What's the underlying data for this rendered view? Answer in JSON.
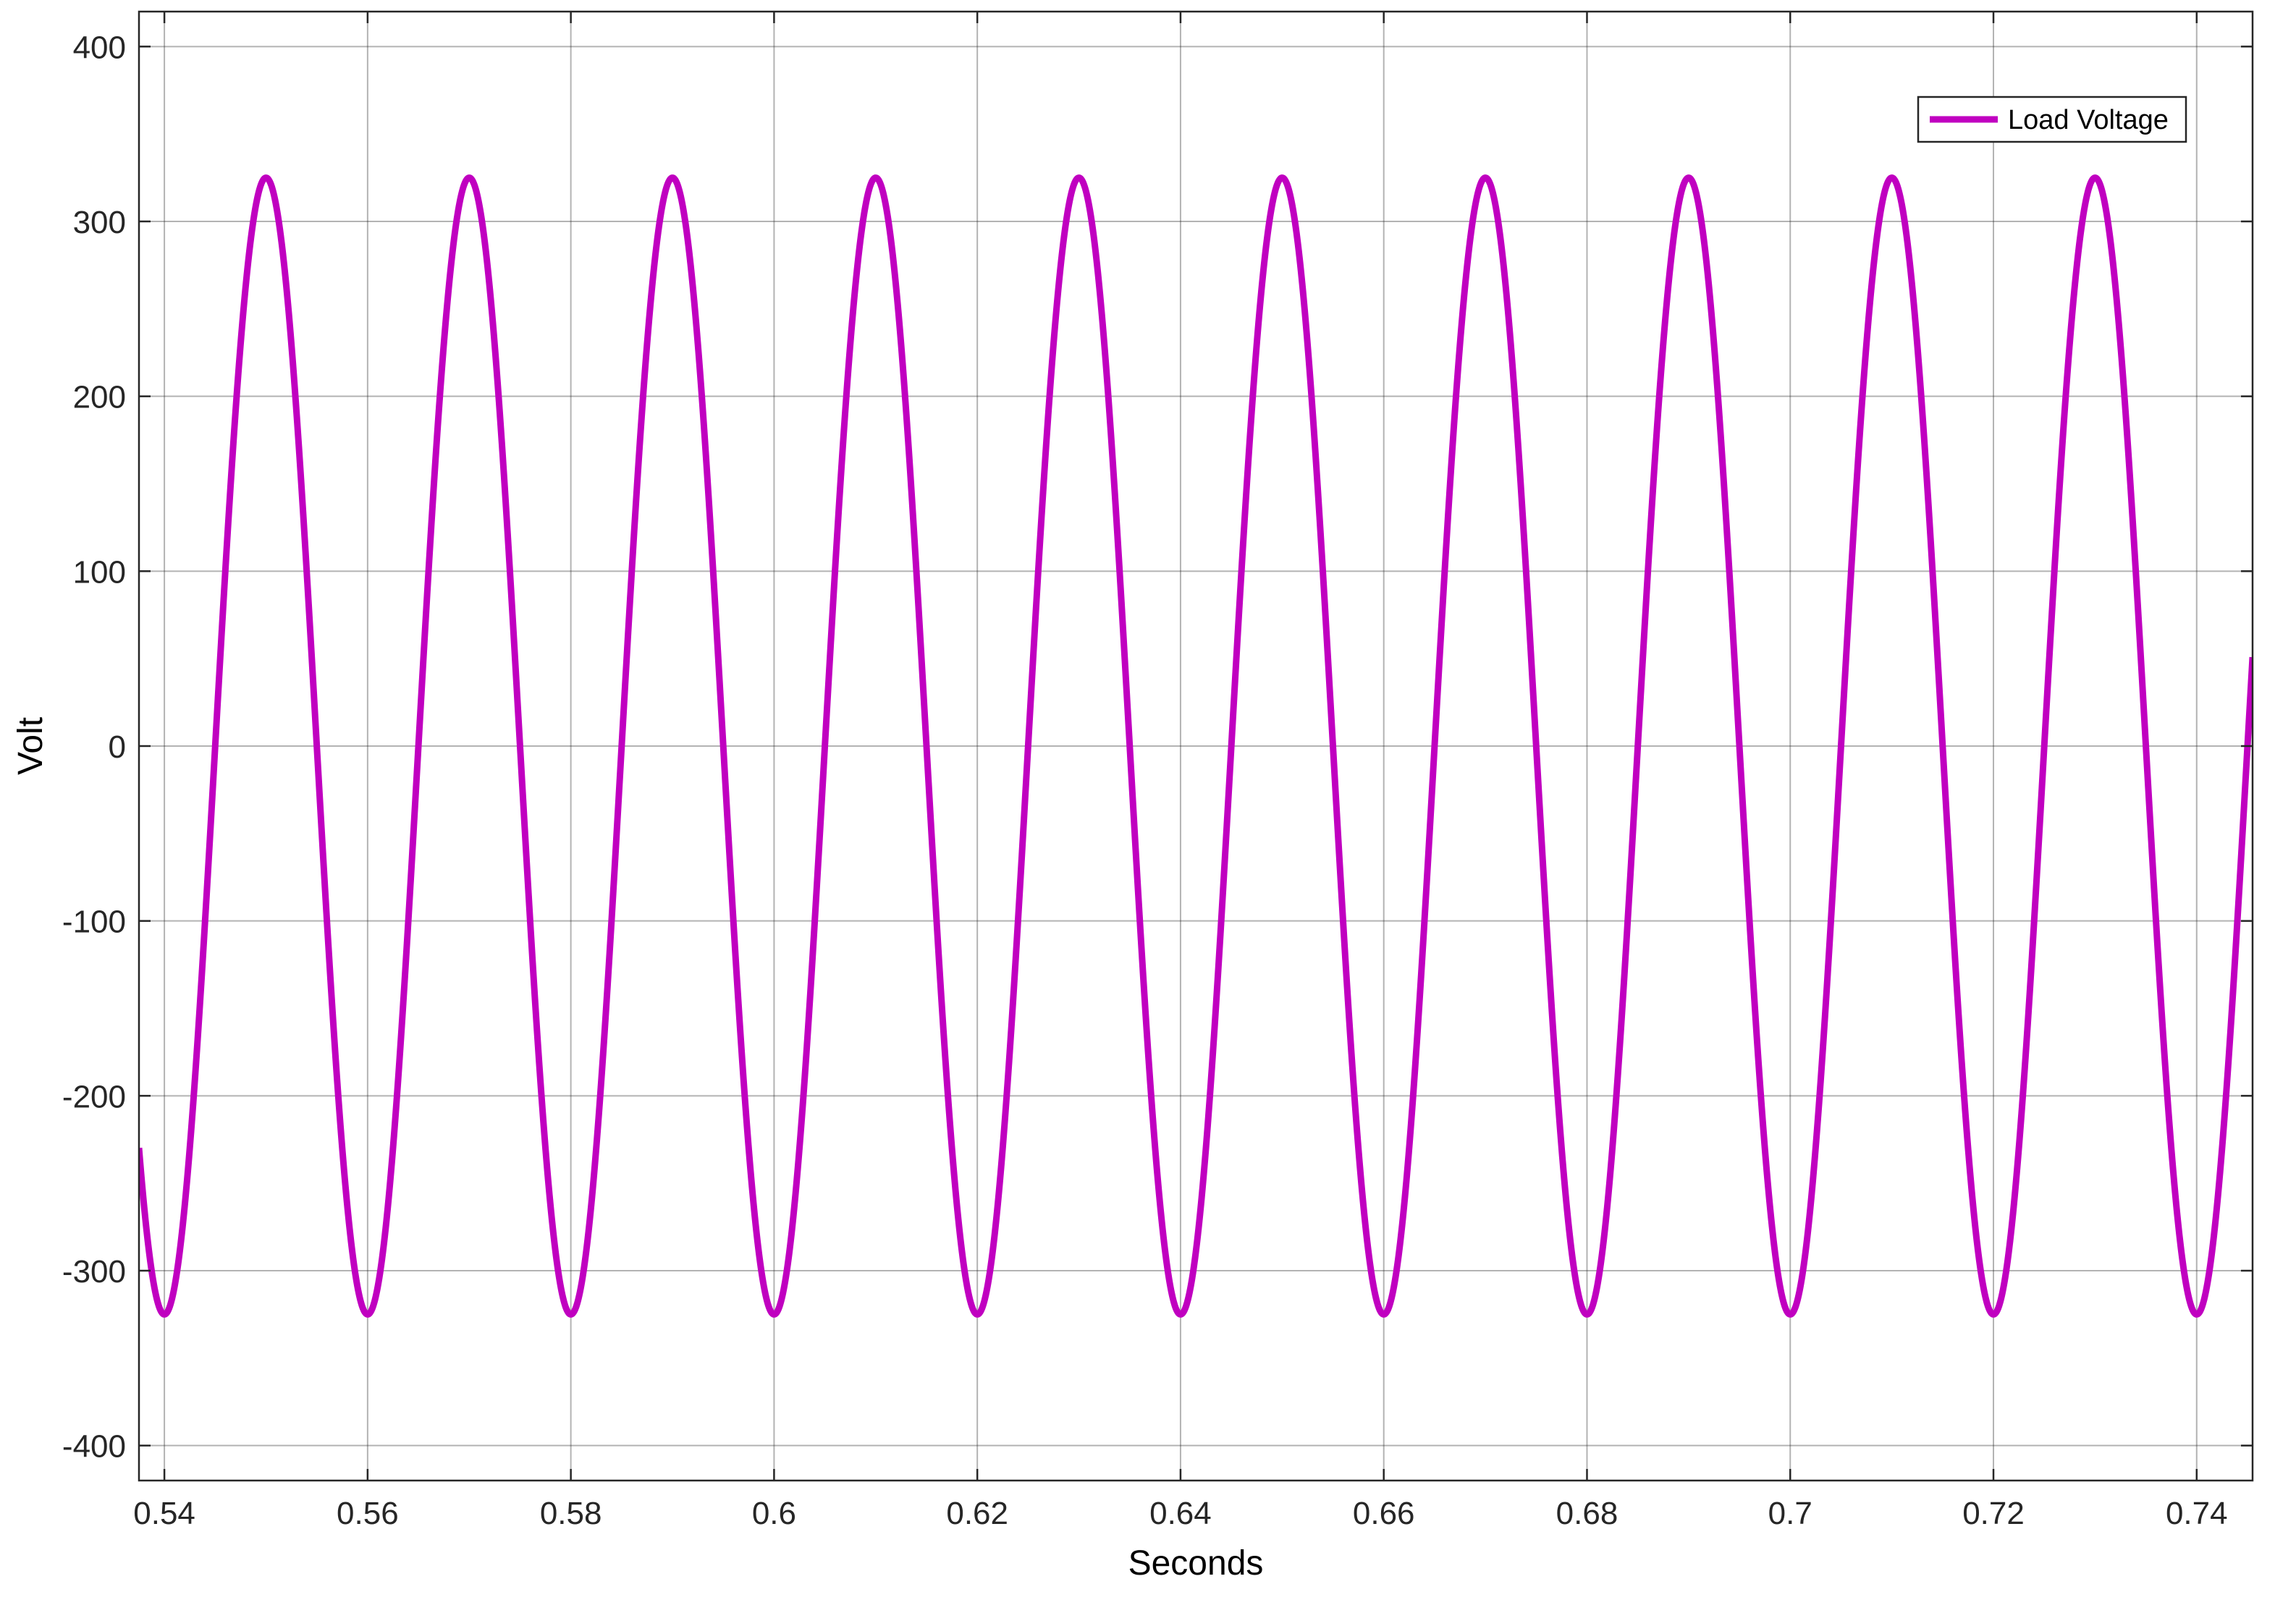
{
  "chart_data": {
    "type": "line",
    "title": "",
    "xlabel": "Seconds",
    "ylabel": "Volt",
    "xlim": [
      0.5375,
      0.7455
    ],
    "ylim": [
      -420,
      420
    ],
    "xticks": [
      0.54,
      0.56,
      0.58,
      0.6,
      0.62,
      0.64,
      0.66,
      0.68,
      0.7,
      0.72,
      0.74
    ],
    "xtick_labels": [
      "0.54",
      "0.56",
      "0.58",
      "0.6",
      "0.62",
      "0.64",
      "0.66",
      "0.68",
      "0.7",
      "0.72",
      "0.74"
    ],
    "yticks": [
      400,
      300,
      200,
      100,
      0,
      -100,
      -200,
      -300,
      -400
    ],
    "ytick_labels": [
      "400",
      "300",
      "200",
      "100",
      "0",
      "-100",
      "-200",
      "-300",
      "-400"
    ],
    "grid": true,
    "legend_position": "top-right",
    "series": [
      {
        "name": "Load Voltage",
        "color": "#c000c0",
        "waveform": "sine",
        "amplitude": 325,
        "frequency_hz": 50,
        "x_of_negative_peaks": [
          0.54,
          0.56,
          0.58,
          0.6,
          0.62,
          0.64,
          0.66,
          0.68,
          0.7,
          0.72,
          0.74
        ],
        "x_of_positive_peaks": [
          0.55,
          0.57,
          0.59,
          0.61,
          0.63,
          0.65,
          0.67,
          0.69,
          0.71,
          0.73
        ]
      }
    ]
  }
}
